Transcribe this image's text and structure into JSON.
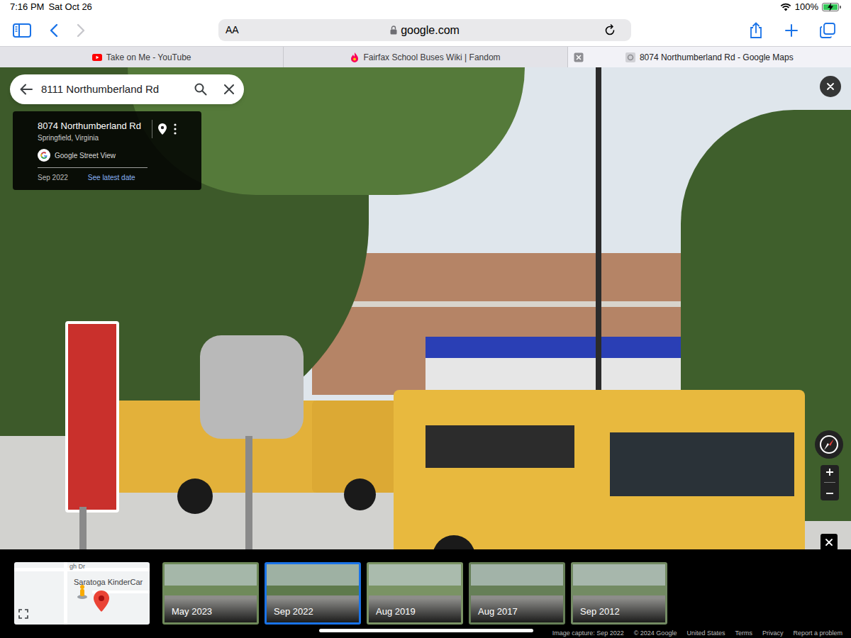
{
  "status_bar": {
    "time": "7:16 PM",
    "date": "Sat Oct 26",
    "battery": "100%",
    "battery_level": 1,
    "charging": true
  },
  "toolbar": {
    "reader": "AA",
    "address": "google.com"
  },
  "tabs": [
    {
      "label": "Take on Me - YouTube",
      "kind": "youtube",
      "selected": false
    },
    {
      "label": "Fairfax School Buses Wiki | Fandom",
      "kind": "fandom",
      "selected": false
    },
    {
      "label": "8074 Northumberland Rd - Google Maps",
      "kind": "maps",
      "selected": true
    }
  ],
  "search": {
    "value": "8111 Northumberland Rd"
  },
  "place_card": {
    "title": "8074 Northumberland Rd",
    "subtitle": "Springfield, Virginia",
    "source": "Google Street View",
    "date": "Sep 2022",
    "link": "See latest date"
  },
  "minimap": {
    "labels": [
      "gh Dr",
      "Saratoga KinderCar"
    ]
  },
  "timeline": [
    {
      "label": "May 2023",
      "selected": false
    },
    {
      "label": "Sep 2022",
      "selected": true
    },
    {
      "label": "Aug 2019",
      "selected": false
    },
    {
      "label": "Aug 2017",
      "selected": false
    },
    {
      "label": "Sep 2012",
      "selected": false
    }
  ],
  "footer": [
    "Image capture: Sep 2022",
    "© 2024 Google",
    "United States",
    "Terms",
    "Privacy",
    "Report a problem"
  ]
}
